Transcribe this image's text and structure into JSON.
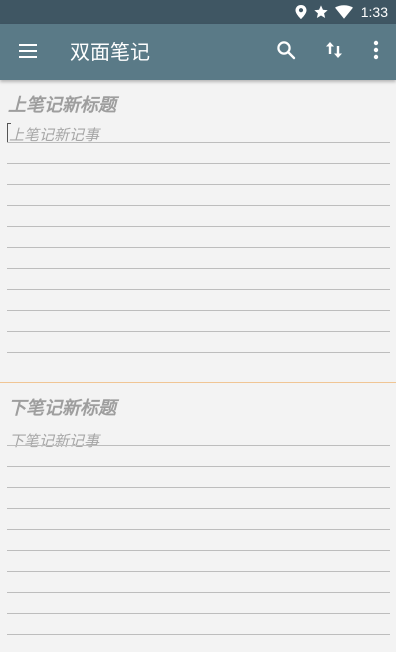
{
  "status_bar": {
    "time": "1:33",
    "icons": [
      "location-icon",
      "star-icon",
      "wifi-icon"
    ]
  },
  "app_bar": {
    "title": "双面笔记",
    "actions": [
      "menu-icon",
      "search-icon",
      "sort-icon",
      "more-vert-icon"
    ],
    "background_color": "#5a7a87"
  },
  "top_note": {
    "title_placeholder": "上笔记新标题",
    "body_placeholder": "上笔记新记事"
  },
  "bottom_note": {
    "title_placeholder": "下笔记新标题",
    "body_placeholder": "下笔记新记事"
  },
  "colors": {
    "status_bar": "#3f5663",
    "divider": "#f0c594",
    "background": "#f3f3f3"
  }
}
